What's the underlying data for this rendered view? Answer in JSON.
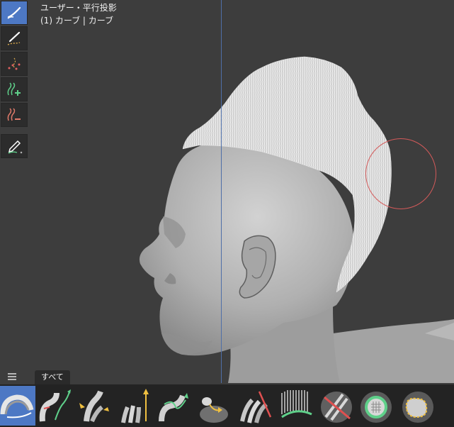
{
  "viewport": {
    "projection_label": "ユーザー・平行投影",
    "selection_label": "(1) カーブ | カーブ"
  },
  "toolbar": {
    "tools": [
      {
        "icon": "draw-brush-icon",
        "active": true
      },
      {
        "icon": "draw-curve-brush-icon",
        "active": false
      },
      {
        "icon": "dotted-curve-icon",
        "active": false
      },
      {
        "icon": "add-curves-icon",
        "active": false
      },
      {
        "icon": "remove-curves-icon",
        "active": false
      },
      {
        "icon": "pen-annotate-icon",
        "active": false
      }
    ]
  },
  "shelf": {
    "tab_label": "すべて",
    "brushes": [
      "comb-brush-icon",
      "add-curve-brush-icon",
      "puff-brush-icon",
      "grow-brush-icon",
      "snake-hook-brush-icon",
      "smooth-brush-icon",
      "slide-brush-icon",
      "density-brush-icon",
      "delete-brush-icon",
      "selection-paint-brush-icon",
      "pinch-brush-icon"
    ]
  },
  "colors": {
    "accent": "#4d78c4",
    "brush_circle": "#d45a5a",
    "background": "#3d3d3d"
  }
}
